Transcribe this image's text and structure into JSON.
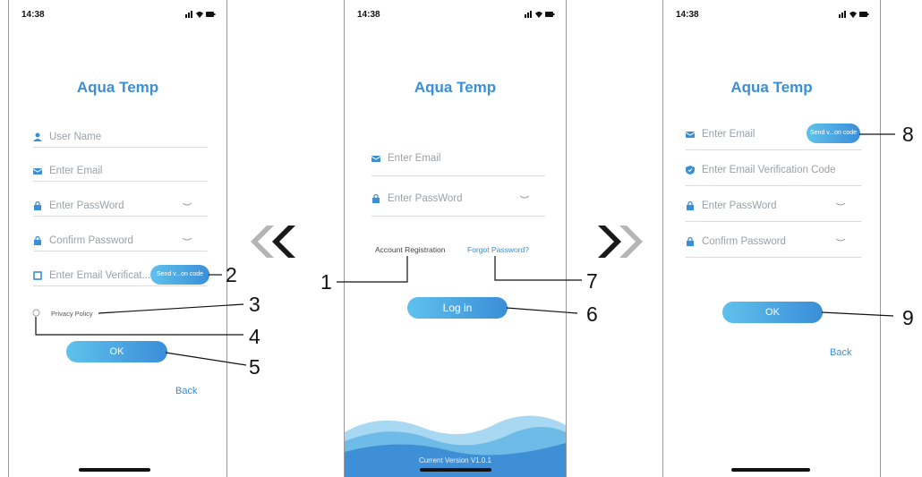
{
  "status_time": "14:38",
  "colors": {
    "accent": "#3a8fd6",
    "button_start": "#5fc1ec",
    "button_end": "#3b8ed8",
    "arrow_dark": "#1a1a1a",
    "arrow_light": "#b5b5b5"
  },
  "register_screen": {
    "title": "Aqua Temp",
    "user_name_placeholder": "User Name",
    "email_placeholder": "Enter Email",
    "password_placeholder": "Enter PassWord",
    "confirm_password_placeholder": "Confirm Password",
    "verification_placeholder": "Enter Email Verificat...",
    "send_code_label": "Send v...on code",
    "privacy_policy_label": "Privacy Policy",
    "ok_label": "OK",
    "back_label": "Back"
  },
  "login_screen": {
    "title": "Aqua Temp",
    "email_placeholder": "Enter Email",
    "password_placeholder": "Enter PassWord",
    "account_registration_label": "Account Registration",
    "forgot_password_label": "Forgot Password?",
    "login_label": "Log in",
    "version_label": "Current Version V1.0.1"
  },
  "reset_screen": {
    "title": "Aqua Temp",
    "email_placeholder": "Enter Email",
    "send_code_label": "Send v...on code",
    "verification_placeholder": "Enter Email Verification Code",
    "password_placeholder": "Enter PassWord",
    "confirm_password_placeholder": "Confirm Password",
    "ok_label": "OK",
    "back_label": "Back"
  },
  "callouts": [
    "1",
    "2",
    "3",
    "4",
    "5",
    "6",
    "7",
    "8",
    "9"
  ]
}
